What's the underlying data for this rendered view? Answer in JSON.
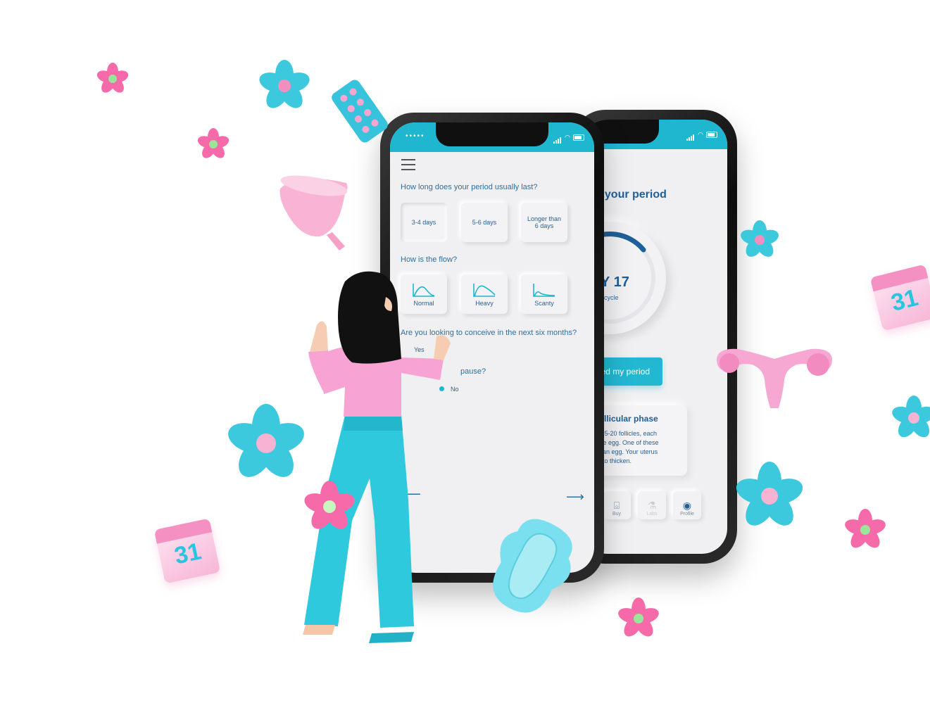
{
  "front_screen": {
    "q1": "How long does your period usually last?",
    "q1_options": [
      "3-4 days",
      "5-6 days",
      "Longer than 6 days"
    ],
    "q2": "How is the flow?",
    "q2_options": [
      "Normal",
      "Heavy",
      "Scanty"
    ],
    "q3": "Are you looking to conceive in the next six months?",
    "q3_yes": "Yes",
    "q4": "pause?",
    "q4_no": "No"
  },
  "back_screen": {
    "title": "s to your period",
    "day": "DAY 17",
    "cycle": "of your cycle",
    "period_button": "rted my period",
    "phase_title": "n a follicular phase",
    "phase_body": [
      "roduces 5-20 follicles, each",
      "immature egg. One of these",
      "res into an egg. Your uterus",
      "g starts to thicken."
    ],
    "nav": [
      "Buy",
      "Labs",
      "Profile"
    ]
  },
  "calendar": {
    "number": "31"
  },
  "colors": {
    "accent": "#1fb6d0",
    "text_blue": "#1f5f9a",
    "pink": "#f490c2"
  }
}
